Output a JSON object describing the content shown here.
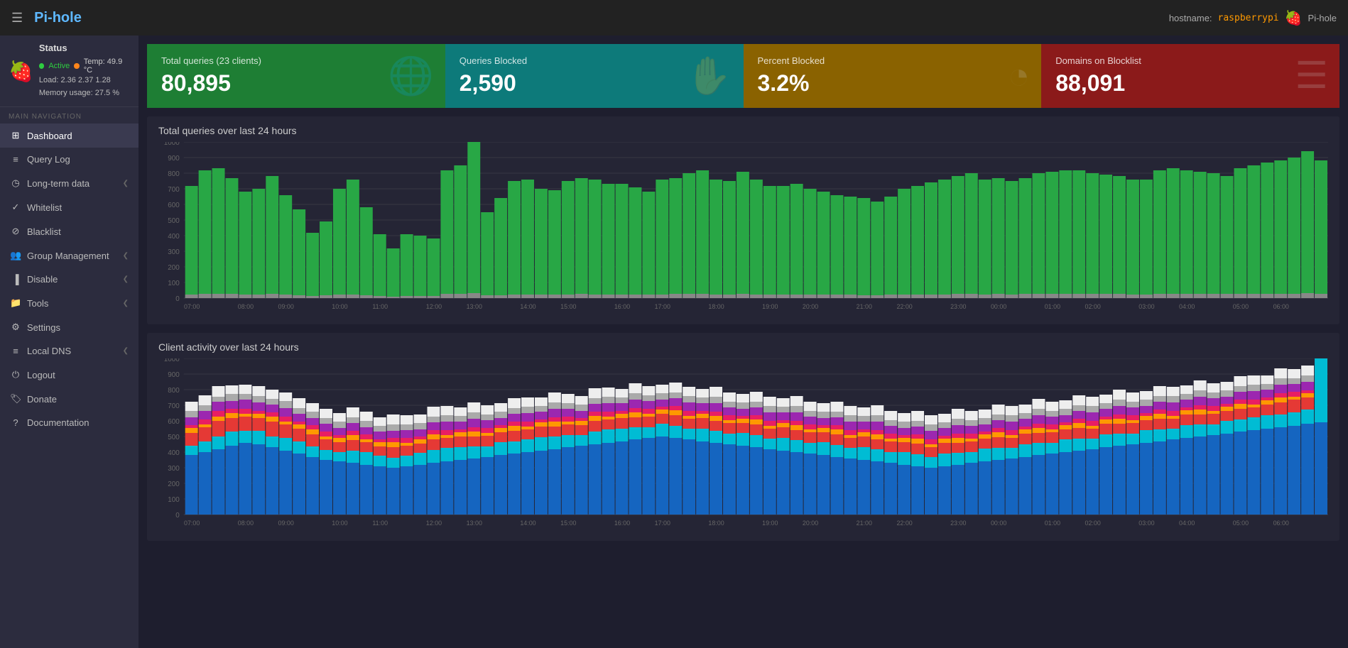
{
  "topbar": {
    "menu_icon": "☰",
    "title": "Pi-hole",
    "hostname_label": "hostname:",
    "hostname_value": "raspberrypi",
    "pi_label": "Pi-hole"
  },
  "sidebar": {
    "status": {
      "title": "Status",
      "active_label": "Active",
      "temp_label": "Temp: 49.9 °C",
      "load_label": "Load: 2.36  2.37  1.28",
      "memory_label": "Memory usage: 27.5 %"
    },
    "nav_section": "MAIN NAVIGATION",
    "items": [
      {
        "label": "Dashboard",
        "icon": "⊞",
        "active": true,
        "has_chevron": false
      },
      {
        "label": "Query Log",
        "icon": "≡",
        "active": false,
        "has_chevron": false
      },
      {
        "label": "Long-term data",
        "icon": "◷",
        "active": false,
        "has_chevron": true
      },
      {
        "label": "Whitelist",
        "icon": "✓",
        "active": false,
        "has_chevron": false
      },
      {
        "label": "Blacklist",
        "icon": "⊘",
        "active": false,
        "has_chevron": false
      },
      {
        "label": "Group Management",
        "icon": "👥",
        "active": false,
        "has_chevron": true
      },
      {
        "label": "Disable",
        "icon": "▐",
        "active": false,
        "has_chevron": true
      },
      {
        "label": "Tools",
        "icon": "📁",
        "active": false,
        "has_chevron": true
      },
      {
        "label": "Settings",
        "icon": "⚙",
        "active": false,
        "has_chevron": false
      },
      {
        "label": "Local DNS",
        "icon": "≡",
        "active": false,
        "has_chevron": true
      },
      {
        "label": "Logout",
        "icon": "⏻",
        "active": false,
        "has_chevron": false
      },
      {
        "label": "Donate",
        "icon": "🏷",
        "active": false,
        "has_chevron": false
      },
      {
        "label": "Documentation",
        "icon": "?",
        "active": false,
        "has_chevron": false
      }
    ]
  },
  "stat_cards": [
    {
      "title": "Total queries (23 clients)",
      "value": "80,895",
      "icon": "🌐",
      "theme": "green"
    },
    {
      "title": "Queries Blocked",
      "value": "2,590",
      "icon": "✋",
      "theme": "teal"
    },
    {
      "title": "Percent Blocked",
      "value": "3.2%",
      "icon": "◔",
      "theme": "gold"
    },
    {
      "title": "Domains on Blocklist",
      "value": "88,091",
      "icon": "≡",
      "theme": "red"
    }
  ],
  "chart1": {
    "title": "Total queries over last 24 hours",
    "y_labels": [
      "1000",
      "900",
      "800",
      "700",
      "600",
      "500",
      "400",
      "300",
      "200",
      "100",
      "0"
    ],
    "x_labels": [
      "07:00",
      "08:00",
      "09:00",
      "10:00",
      "11:00",
      "12:00",
      "13:00",
      "14:00",
      "15:00",
      "16:00",
      "17:00",
      "18:00",
      "19:00",
      "20:00",
      "21:00",
      "22:00",
      "23:00",
      "00:00",
      "01:00",
      "02:00",
      "03:00",
      "04:00",
      "05:00",
      "06:00"
    ]
  },
  "chart2": {
    "title": "Client activity over last 24 hours",
    "y_labels": [
      "1000",
      "900",
      "800",
      "700",
      "600",
      "500",
      "400",
      "300",
      "200",
      "100",
      "0"
    ],
    "x_labels": [
      "07:00",
      "08:00",
      "09:00",
      "10:00",
      "11:00",
      "12:00",
      "13:00",
      "14:00",
      "15:00",
      "16:00",
      "17:00",
      "18:00",
      "19:00",
      "20:00",
      "21:00",
      "22:00",
      "23:00",
      "00:00",
      "01:00",
      "02:00",
      "03:00",
      "04:00",
      "05:00",
      "06:00"
    ]
  },
  "colors": {
    "accent_green": "#2ecc40",
    "accent_teal": "#00bcd4",
    "accent_blue": "#1e88e5",
    "accent_red": "#e53935",
    "accent_orange": "#ff9800",
    "accent_pink": "#e91e63",
    "bar_green": "#28a745",
    "bar_gray": "#555"
  }
}
